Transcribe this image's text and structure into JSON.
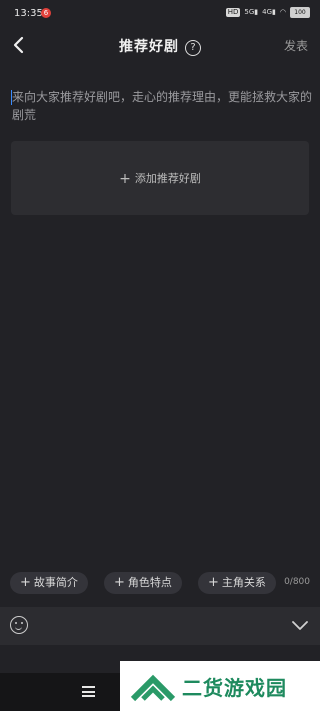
{
  "status_bar": {
    "time": "13:35",
    "notification_badge": "6",
    "battery": "100"
  },
  "header": {
    "title": "推荐好剧",
    "help": "?",
    "publish_label": "发表"
  },
  "editor": {
    "placeholder": "来向大家推荐好剧吧，走心的推荐理由，更能拯救大家的剧荒"
  },
  "add_box": {
    "plus": "+",
    "label": "添加推荐好剧"
  },
  "tags": [
    {
      "plus": "+",
      "label": "故事简介"
    },
    {
      "plus": "+",
      "label": "角色特点"
    },
    {
      "plus": "+",
      "label": "主角关系"
    }
  ],
  "char_count": "0/800",
  "watermark": {
    "text": "二货游戏园"
  },
  "colors": {
    "background": "#222226",
    "panel": "#2d2d31",
    "caret": "#3b8cff",
    "watermark_green": "#1e8a5e"
  }
}
